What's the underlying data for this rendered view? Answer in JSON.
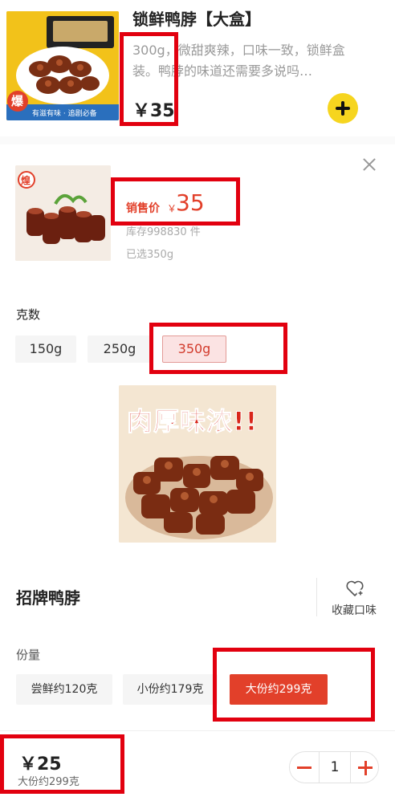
{
  "product": {
    "title": "锁鲜鸭脖【大盒】",
    "description": "300g，微甜爽辣，口味一致，锁鲜盒装。鸭脖的味道还需要多说吗…",
    "price": "￥35",
    "image_badge": "爆",
    "image_caption": "有滋有味 · 追剧必备"
  },
  "spec": {
    "sale_label": "销售价",
    "sale_currency": "￥",
    "sale_price": "35",
    "stock": "库存998830 件",
    "chosen": "已选350g",
    "thumb_badge": "煌"
  },
  "weight": {
    "label": "克数",
    "options": [
      "150g",
      "250g",
      "350g"
    ],
    "selected": "350g"
  },
  "promo": {
    "text": "肉厚味浓!!"
  },
  "signature": {
    "title": "招牌鸭脖",
    "favorite_label": "收藏口味"
  },
  "portion": {
    "label": "份量",
    "options": [
      "尝鲜约120克",
      "小份约179克",
      "大份约299克"
    ],
    "selected": "大份约299克"
  },
  "bottom": {
    "price": "￥25",
    "portion_note": "大份约299克",
    "quantity": "1"
  },
  "colors": {
    "accent_red": "#e2402a",
    "highlight_box": "#e2000f",
    "add_button": "#f6d51f"
  }
}
